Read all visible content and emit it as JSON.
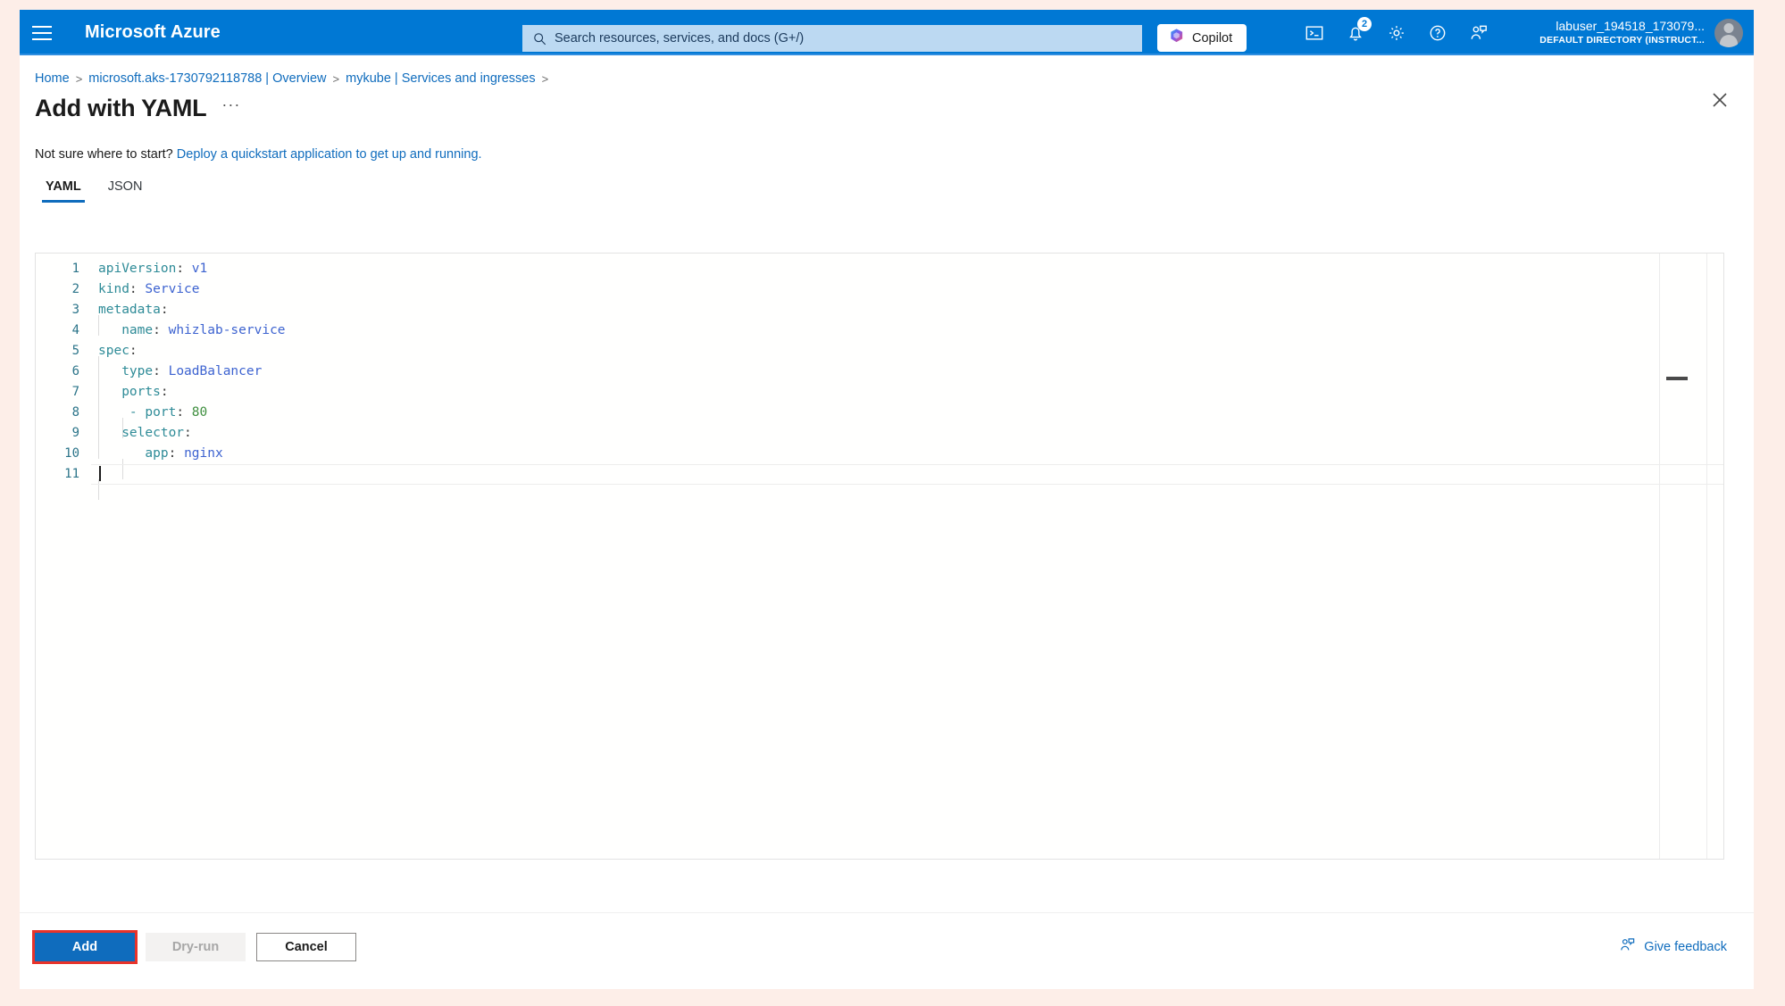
{
  "header": {
    "brand": "Microsoft Azure",
    "menu_icon": "hamburger-icon",
    "search": {
      "placeholder": "Search resources, services, and docs (G+/)",
      "value": "",
      "icon": "search-icon"
    },
    "copilot": {
      "label": "Copilot",
      "icon": "copilot-icon"
    },
    "icons": [
      {
        "name": "cloud-shell-icon",
        "glyph": ">_"
      },
      {
        "name": "notifications-bell-icon",
        "badge": "2"
      },
      {
        "name": "settings-gear-icon"
      },
      {
        "name": "help-question-icon"
      },
      {
        "name": "feedback-person-icon"
      }
    ],
    "account": {
      "name": "labuser_194518_173079...",
      "directory": "DEFAULT DIRECTORY (INSTRUCT...",
      "avatar": "user-avatar-icon"
    },
    "accent_color": "#0078d4"
  },
  "breadcrumb": {
    "items": [
      "Home",
      "microsoft.aks-1730792118788 | Overview",
      "mykube | Services and ingresses"
    ],
    "separator": ">",
    "trailing_separator": ">"
  },
  "page": {
    "title": "Add with YAML",
    "ellipsis": "···",
    "close_icon": "close-icon"
  },
  "quickstart": {
    "prompt": "Not sure where to start?",
    "link": "Deploy a quickstart application to get up and running."
  },
  "tabs": [
    {
      "label": "YAML",
      "active": true
    },
    {
      "label": "JSON",
      "active": false
    }
  ],
  "editor": {
    "language": "yaml",
    "cursor_line": 11,
    "total_lines": 11,
    "line_numbers": [
      "1",
      "2",
      "3",
      "4",
      "5",
      "6",
      "7",
      "8",
      "9",
      "10",
      "11"
    ],
    "lines": [
      {
        "n": 1,
        "tokens": [
          {
            "t": "apiVersion",
            "c": "k"
          },
          {
            "t": ":",
            "c": "p"
          },
          {
            "t": " ",
            "c": "p"
          },
          {
            "t": "v1",
            "c": "v"
          }
        ]
      },
      {
        "n": 2,
        "tokens": [
          {
            "t": "kind",
            "c": "k"
          },
          {
            "t": ":",
            "c": "p"
          },
          {
            "t": " ",
            "c": "p"
          },
          {
            "t": "Service",
            "c": "v"
          }
        ]
      },
      {
        "n": 3,
        "tokens": [
          {
            "t": "metadata",
            "c": "k"
          },
          {
            "t": ":",
            "c": "p"
          }
        ]
      },
      {
        "n": 4,
        "tokens": [
          {
            "t": "   ",
            "c": "p"
          },
          {
            "t": "name",
            "c": "k"
          },
          {
            "t": ":",
            "c": "p"
          },
          {
            "t": " ",
            "c": "p"
          },
          {
            "t": "whizlab-service",
            "c": "v"
          }
        ]
      },
      {
        "n": 5,
        "tokens": [
          {
            "t": "spec",
            "c": "k"
          },
          {
            "t": ":",
            "c": "p"
          }
        ]
      },
      {
        "n": 6,
        "tokens": [
          {
            "t": "   ",
            "c": "p"
          },
          {
            "t": "type",
            "c": "k"
          },
          {
            "t": ":",
            "c": "p"
          },
          {
            "t": " ",
            "c": "p"
          },
          {
            "t": "LoadBalancer",
            "c": "v"
          }
        ]
      },
      {
        "n": 7,
        "tokens": [
          {
            "t": "   ",
            "c": "p"
          },
          {
            "t": "ports",
            "c": "k"
          },
          {
            "t": ":",
            "c": "p"
          }
        ]
      },
      {
        "n": 8,
        "tokens": [
          {
            "t": "    ",
            "c": "p"
          },
          {
            "t": "-",
            "c": "d"
          },
          {
            "t": " ",
            "c": "p"
          },
          {
            "t": "port",
            "c": "k"
          },
          {
            "t": ":",
            "c": "p"
          },
          {
            "t": " ",
            "c": "p"
          },
          {
            "t": "80",
            "c": "n"
          }
        ]
      },
      {
        "n": 9,
        "tokens": [
          {
            "t": "   ",
            "c": "p"
          },
          {
            "t": "selector",
            "c": "k"
          },
          {
            "t": ":",
            "c": "p"
          }
        ]
      },
      {
        "n": 10,
        "tokens": [
          {
            "t": "      ",
            "c": "p"
          },
          {
            "t": "app",
            "c": "k"
          },
          {
            "t": ":",
            "c": "p"
          },
          {
            "t": " ",
            "c": "p"
          },
          {
            "t": "nginx",
            "c": "v"
          }
        ]
      },
      {
        "n": 11,
        "tokens": []
      }
    ],
    "raw_text": "apiVersion: v1\nkind: Service\nmetadata:\n   name: whizlab-service\nspec:\n   type: LoadBalancer\n   ports:\n    - port: 80\n   selector:\n      app: nginx\n",
    "colors": {
      "key": "#2e8b97",
      "value": "#3d63d0",
      "number": "#3f8f3f",
      "line_number": "#2b7489"
    }
  },
  "footer": {
    "add_label": "Add",
    "dryrun_label": "Dry-run",
    "cancel_label": "Cancel",
    "feedback_label": "Give feedback",
    "feedback_icon": "feedback-person-icon",
    "highlight_color": "#e8332a"
  }
}
